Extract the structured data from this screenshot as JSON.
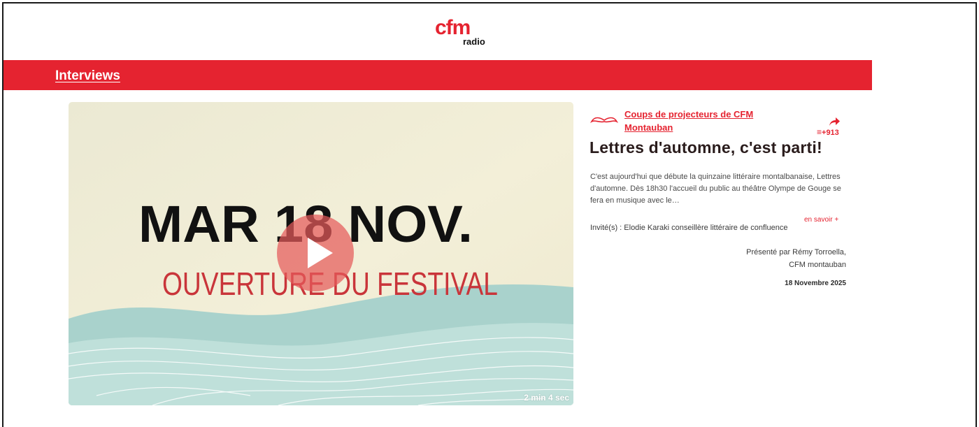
{
  "brand": {
    "logo_main": "cfm",
    "logo_sub": "radio",
    "accent_color": "#e52330"
  },
  "section": {
    "title": "Interviews"
  },
  "video": {
    "poster_line1": "MAR 18 NOV.",
    "poster_line2": "OUVERTURE DU FESTIVAL",
    "duration": "2 min 4 sec"
  },
  "episode": {
    "program": "Coups de projecteurs de CFM Montauban",
    "playlist_count": "+913",
    "title": "Lettres d'automne, c'est parti!",
    "description": "C'est aujourd'hui que débute la quinzaine littéraire montalbanaise, Lettres d'automne. Dès 18h30 l'accueil du public au théâtre Olympe de Gouge se fera en musique avec le…",
    "more_label": "en savoir +",
    "guests": "Invité(s) : Elodie Karaki conseillère littéraire de confluence",
    "presenter_line1": "Présenté par Rémy Torroella,",
    "presenter_line2": "CFM montauban",
    "date": "18 Novembre 2025"
  },
  "icons": {
    "program": "mustache-icon",
    "share": "share-arrow-icon",
    "playlist": "playlist-icon",
    "play": "play-icon"
  }
}
